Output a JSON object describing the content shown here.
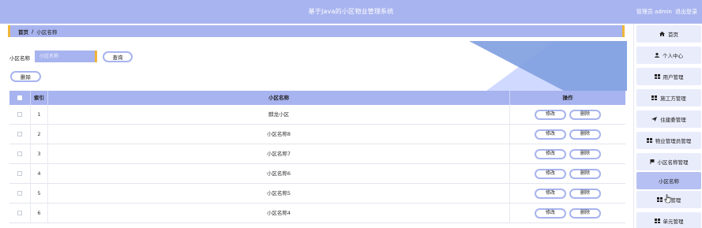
{
  "header": {
    "title": "基于Java的小区物业管理系统",
    "role_user": "管理员 admin",
    "logout": "退出登录"
  },
  "breadcrumb": {
    "home": "首页",
    "separator": "/",
    "current": "小区名称"
  },
  "search": {
    "label": "小区名称",
    "placeholder": "小区名称",
    "value": "",
    "button": "查询"
  },
  "toolbar": {
    "delete": "删除"
  },
  "table": {
    "headers": {
      "index": "索引",
      "name": "小区名称",
      "op": "操作"
    },
    "edit_label": "修改",
    "delete_label": "删除",
    "rows": [
      {
        "index": "1",
        "name": "麒龙小区"
      },
      {
        "index": "2",
        "name": "小区名称8"
      },
      {
        "index": "3",
        "name": "小区名称7"
      },
      {
        "index": "4",
        "name": "小区名称6"
      },
      {
        "index": "5",
        "name": "小区名称5"
      },
      {
        "index": "6",
        "name": "小区名称4"
      }
    ]
  },
  "sidebar": {
    "items": [
      {
        "label": "首页",
        "icon": "home-icon",
        "active": false
      },
      {
        "label": "个人中心",
        "icon": "user-icon",
        "active": false
      },
      {
        "label": "用户管理",
        "icon": "grid-icon",
        "active": false
      },
      {
        "label": "施工方管理",
        "icon": "grid-icon",
        "active": false
      },
      {
        "label": "住建委管理",
        "icon": "send-icon",
        "active": false
      },
      {
        "label": "物业管理员管理",
        "icon": "grid-icon",
        "active": false
      },
      {
        "label": "小区名称管理",
        "icon": "flag-icon",
        "active": false
      },
      {
        "label": "小区名称",
        "icon": "",
        "active": true
      },
      {
        "label": "栋管理",
        "icon": "grid-icon",
        "active": false
      },
      {
        "label": "单元管理",
        "icon": "grid-icon",
        "active": false
      }
    ]
  },
  "colors": {
    "accent": "#a8b4ef",
    "highlight": "#f0b63a",
    "deco_dark": "#7f9ee0",
    "deco_light": "#c8d2ff"
  }
}
